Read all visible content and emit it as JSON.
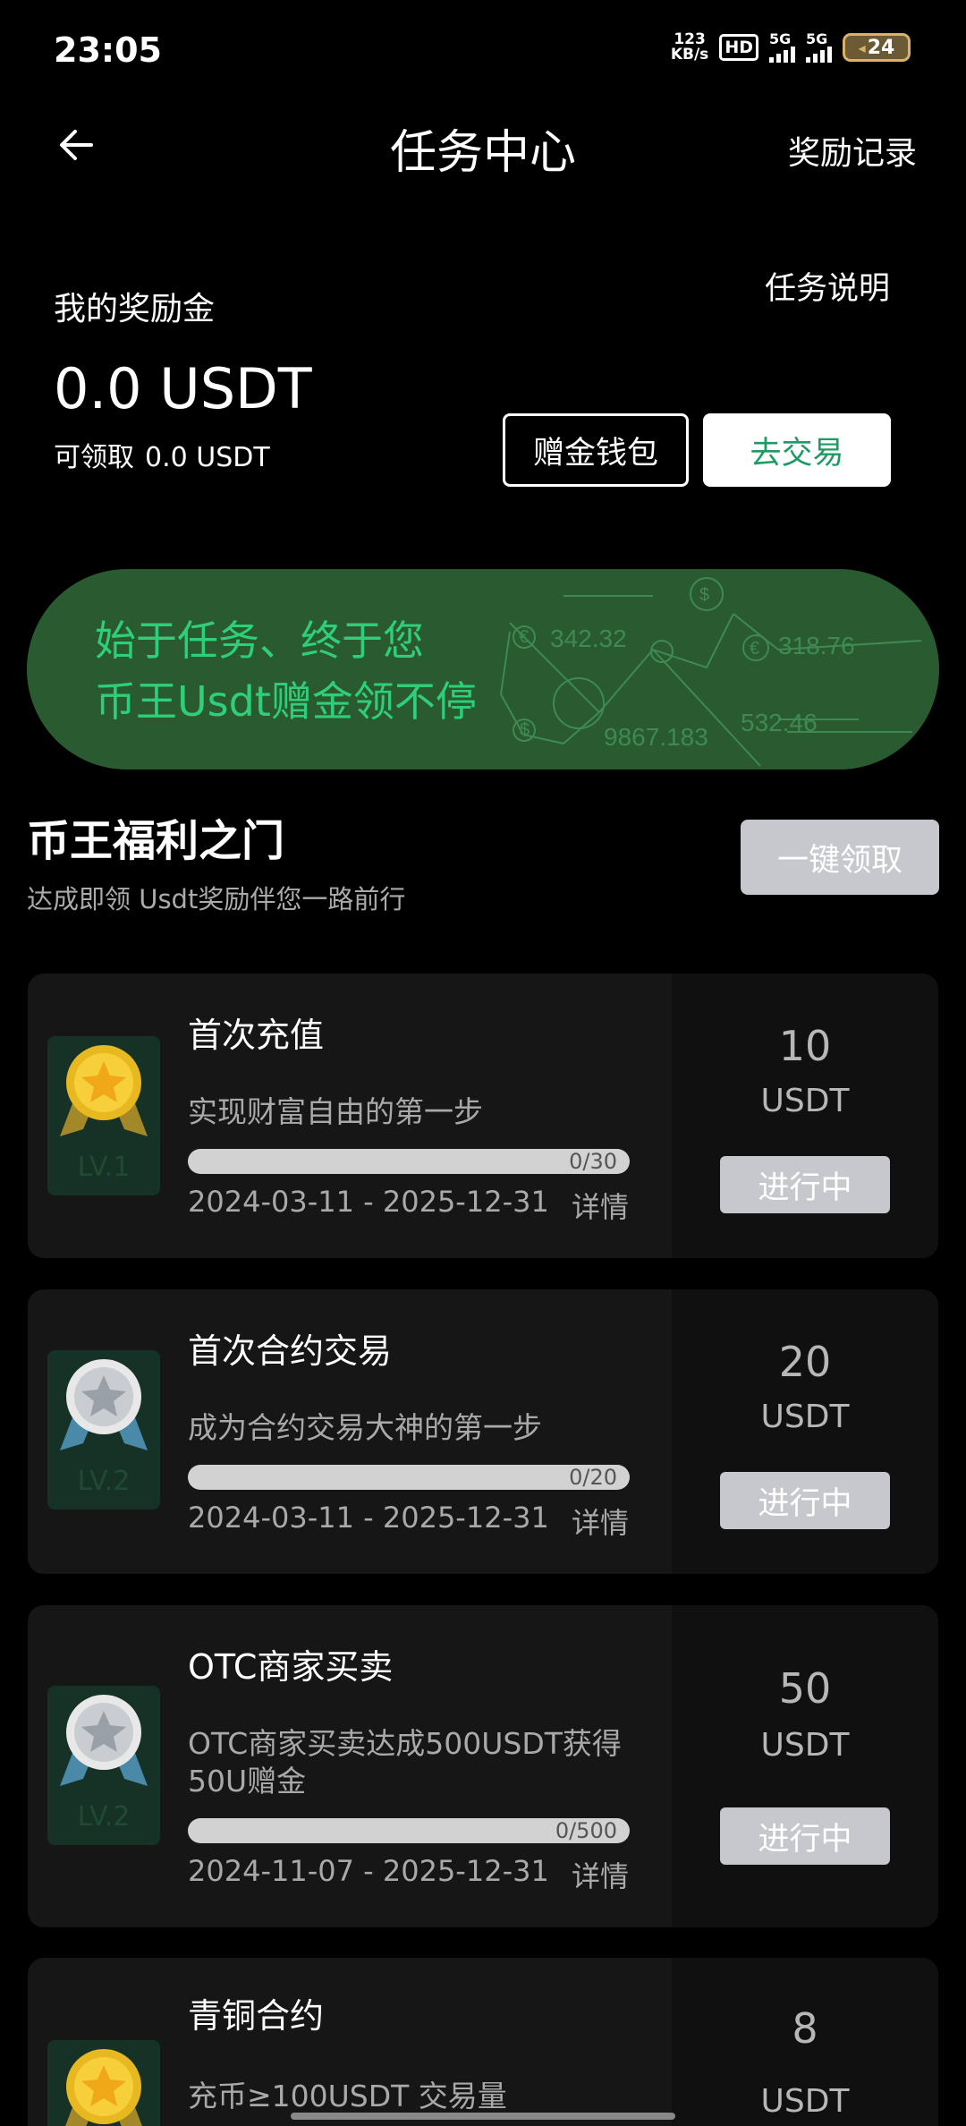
{
  "status_bar": {
    "time": "23:05",
    "net_speed_value": "123",
    "net_speed_unit": "KB/s",
    "hd_label": "HD",
    "signal1": "5G",
    "signal2": "5G",
    "battery": "24"
  },
  "header": {
    "title": "任务中心",
    "reward_records": "奖励记录",
    "back_icon": "arrow-left-icon"
  },
  "balance": {
    "label": "我的奖励金",
    "task_info": "任务说明",
    "amount": "0.0 USDT",
    "claimable_label": "可领取",
    "claimable_value": "0.0 USDT",
    "wallet_button": "赠金钱包",
    "trade_button": "去交易"
  },
  "banner": {
    "line1": "始于任务、终于您",
    "line2": "币王Usdt赠金领不停",
    "numbers": [
      "342.32",
      "318.76",
      "9867.183",
      "532.46"
    ]
  },
  "section": {
    "title": "币王福利之门",
    "subtitle": "达成即领 Usdt奖励伴您一路前行",
    "claim_all": "一键领取"
  },
  "tasks": [
    {
      "title": "首次充值",
      "desc": "实现财富自由的第一步",
      "progress_text": "0/30",
      "progress": 0,
      "dates": "2024-03-11 - 2025-12-31",
      "detail": "详情",
      "amount": "10",
      "unit": "USDT",
      "status": "进行中",
      "level": "LV.1",
      "medal": "gold"
    },
    {
      "title": "首次合约交易",
      "desc": "成为合约交易大神的第一步",
      "progress_text": "0/20",
      "progress": 0,
      "dates": "2024-03-11 - 2025-12-31",
      "detail": "详情",
      "amount": "20",
      "unit": "USDT",
      "status": "进行中",
      "level": "LV.2",
      "medal": "silver"
    },
    {
      "title": "OTC商家买卖",
      "desc": "OTC商家买卖达成500USDT获得50U赠金",
      "progress_text": "0/500",
      "progress": 0,
      "dates": "2024-11-07 - 2025-12-31",
      "detail": "详情",
      "amount": "50",
      "unit": "USDT",
      "status": "进行中",
      "level": "LV.2",
      "medal": "silver"
    },
    {
      "title": "青铜合约",
      "desc": "充币≥100USDT 交易量",
      "amount": "8",
      "unit": "USDT",
      "medal": "gold"
    }
  ]
}
